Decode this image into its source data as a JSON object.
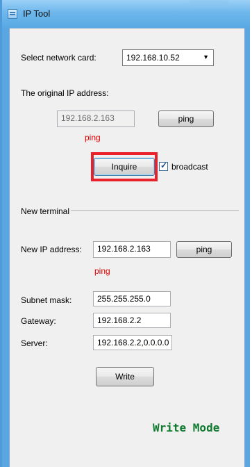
{
  "window": {
    "title": "IP Tool"
  },
  "network": {
    "label": "Select network card:",
    "selected": "192.168.10.52"
  },
  "original": {
    "label": "The original IP address:",
    "ip": "192.168.2.163",
    "ping_label": "ping",
    "ping_status": "ping"
  },
  "inquire": {
    "label": "Inquire",
    "broadcast_label": "broadcast",
    "broadcast_checked": true
  },
  "terminal": {
    "group_label": "New terminal",
    "new_ip_label": "New IP address:",
    "new_ip": "192.168.2.163",
    "ping_label": "ping",
    "ping_status": "ping",
    "subnet_label": "Subnet mask:",
    "subnet": "255.255.255.0",
    "gateway_label": "Gateway:",
    "gateway": "192.168.2.2",
    "server_label": "Server:",
    "server": "192.168.2.2,0.0.0.0",
    "write_label": "Write"
  },
  "mode_caption": "Write Mode",
  "colors": {
    "highlight": "#e8212b",
    "status_red": "#e00000",
    "mode_green": "#0d7a2d"
  }
}
